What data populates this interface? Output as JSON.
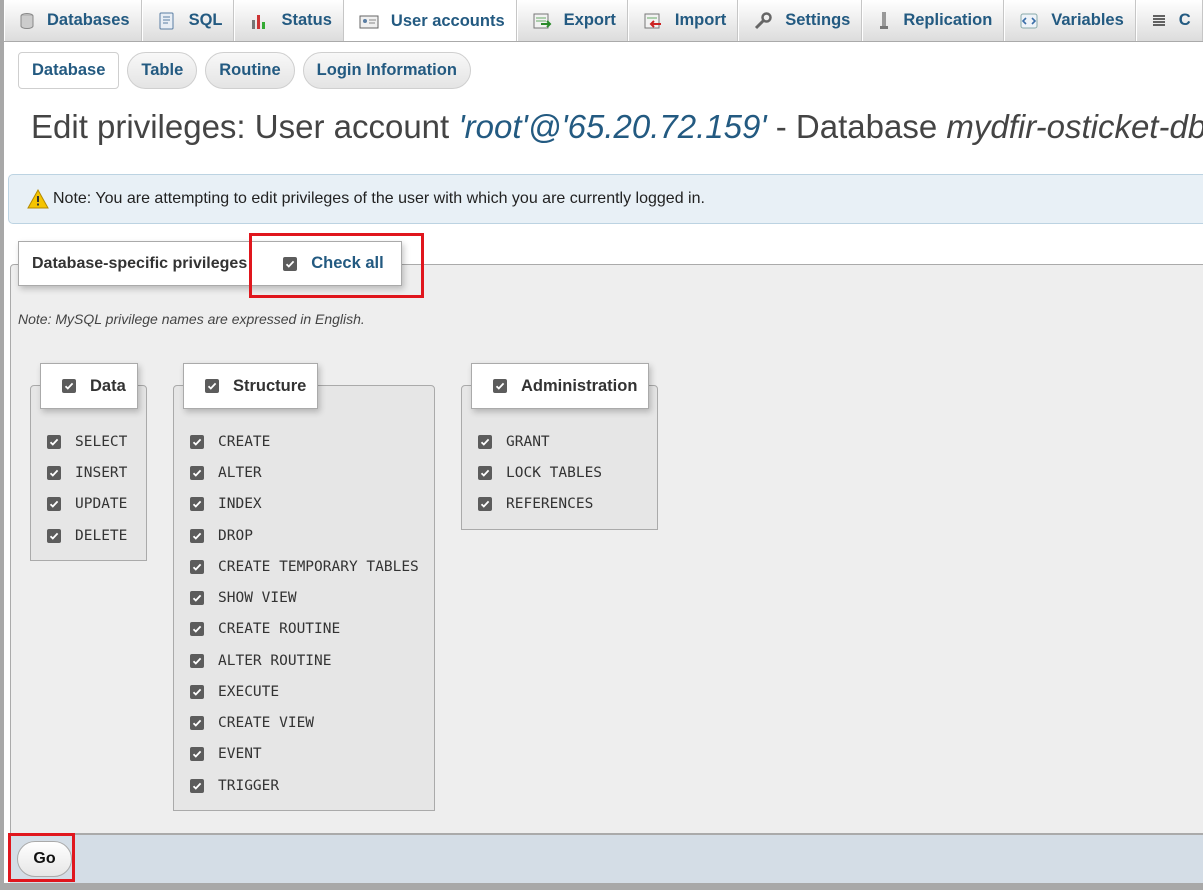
{
  "nav": {
    "tabs": [
      {
        "label": "Databases",
        "icon": "database-icon"
      },
      {
        "label": "SQL",
        "icon": "sql-icon"
      },
      {
        "label": "Status",
        "icon": "status-icon"
      },
      {
        "label": "User accounts",
        "icon": "user-accounts-icon",
        "active": true
      },
      {
        "label": "Export",
        "icon": "export-icon"
      },
      {
        "label": "Import",
        "icon": "import-icon"
      },
      {
        "label": "Settings",
        "icon": "wrench-icon"
      },
      {
        "label": "Replication",
        "icon": "replication-icon"
      },
      {
        "label": "Variables",
        "icon": "variables-icon"
      },
      {
        "label": "C",
        "icon": "list-icon"
      }
    ]
  },
  "subtabs": [
    "Database",
    "Table",
    "Routine",
    "Login Information"
  ],
  "title": {
    "prefix": "Edit privileges: User account ",
    "account": "'root'@'65.20.72.159'",
    "middle": " - Database ",
    "database": "mydfir-osticket-db"
  },
  "notice": {
    "text": "Note: You are attempting to edit privileges of the user with which you are currently logged in."
  },
  "privileges": {
    "legend": "Database-specific privileges",
    "check_all": "Check all",
    "note": "Note: MySQL privilege names are expressed in English.",
    "groups": {
      "data": {
        "label": "Data",
        "items": [
          "SELECT",
          "INSERT",
          "UPDATE",
          "DELETE"
        ]
      },
      "structure": {
        "label": "Structure",
        "items": [
          "CREATE",
          "ALTER",
          "INDEX",
          "DROP",
          "CREATE TEMPORARY TABLES",
          "SHOW VIEW",
          "CREATE ROUTINE",
          "ALTER ROUTINE",
          "EXECUTE",
          "CREATE VIEW",
          "EVENT",
          "TRIGGER"
        ]
      },
      "administration": {
        "label": "Administration",
        "items": [
          "GRANT",
          "LOCK TABLES",
          "REFERENCES"
        ]
      }
    }
  },
  "footer": {
    "go_label": "Go"
  },
  "colors": {
    "link": "#235a81",
    "highlight": "#e0161d"
  }
}
